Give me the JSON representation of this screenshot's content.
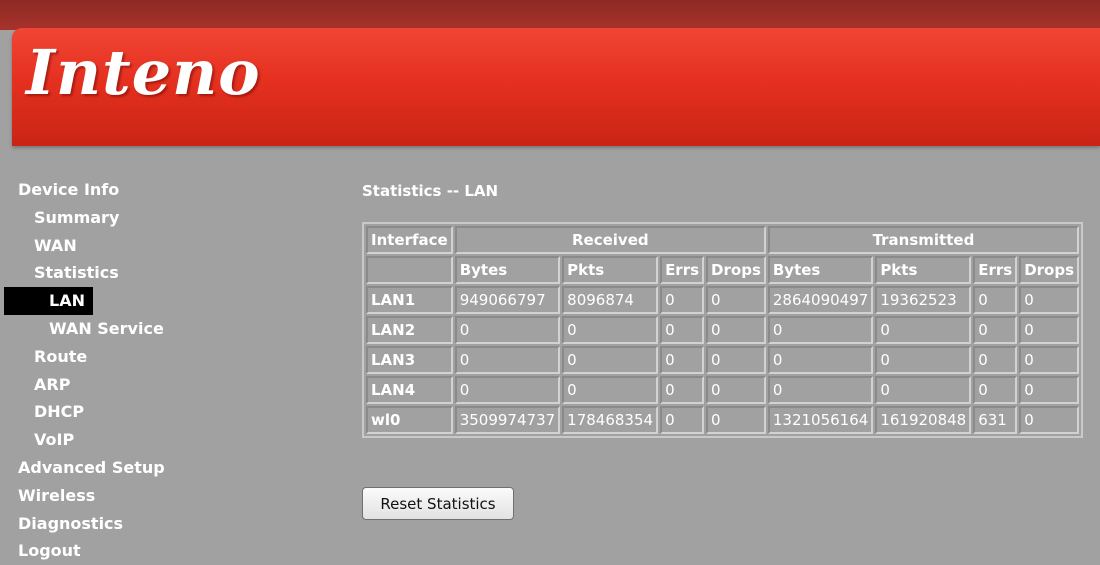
{
  "brand": {
    "logo_text": "Inteno"
  },
  "nav": {
    "items": [
      {
        "label": "Device Info",
        "level": 1
      },
      {
        "label": "Summary",
        "level": 2
      },
      {
        "label": "WAN",
        "level": 2
      },
      {
        "label": "Statistics",
        "level": 2
      },
      {
        "label": "LAN",
        "level": 3,
        "active": true
      },
      {
        "label": "WAN Service",
        "level": 3
      },
      {
        "label": "Route",
        "level": 2
      },
      {
        "label": "ARP",
        "level": 2
      },
      {
        "label": "DHCP",
        "level": 2
      },
      {
        "label": "VoIP",
        "level": 2
      },
      {
        "label": "Advanced Setup",
        "level": 1
      },
      {
        "label": "Wireless",
        "level": 1
      },
      {
        "label": "Diagnostics",
        "level": 1
      },
      {
        "label": "Logout",
        "level": 1
      }
    ]
  },
  "page": {
    "title": "Statistics -- LAN"
  },
  "stats": {
    "interface_header": "Interface",
    "received_header": "Received",
    "transmitted_header": "Transmitted",
    "subheaders": [
      "Bytes",
      "Pkts",
      "Errs",
      "Drops",
      "Bytes",
      "Pkts",
      "Errs",
      "Drops"
    ],
    "rows": [
      {
        "name": "LAN1",
        "values": [
          "949066797",
          "8096874",
          "0",
          "0",
          "2864090497",
          "19362523",
          "0",
          "0"
        ]
      },
      {
        "name": "LAN2",
        "values": [
          "0",
          "0",
          "0",
          "0",
          "0",
          "0",
          "0",
          "0"
        ]
      },
      {
        "name": "LAN3",
        "values": [
          "0",
          "0",
          "0",
          "0",
          "0",
          "0",
          "0",
          "0"
        ]
      },
      {
        "name": "LAN4",
        "values": [
          "0",
          "0",
          "0",
          "0",
          "0",
          "0",
          "0",
          "0"
        ]
      },
      {
        "name": "wl0",
        "values": [
          "3509974737",
          "178468354",
          "0",
          "0",
          "1321056164",
          "161920848",
          "631",
          "0"
        ]
      }
    ]
  },
  "buttons": {
    "reset_label": "Reset Statistics"
  }
}
